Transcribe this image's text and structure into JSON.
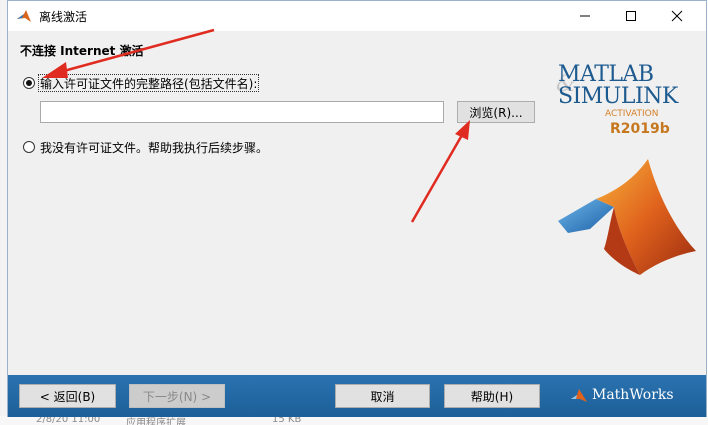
{
  "window": {
    "title": "离线激活",
    "controls": {
      "minimize": "minimize-icon",
      "maximize": "maximize-icon",
      "close": "close-icon"
    }
  },
  "header": {
    "label": "不连接 Internet 激活"
  },
  "options": {
    "license_path": {
      "label": "输入许可证文件的完整路径(包括文件名):",
      "selected": true
    },
    "no_license": {
      "label": "我没有许可证文件。帮助我执行后续步骤。",
      "selected": false
    }
  },
  "path_input": {
    "value": "",
    "placeholder": ""
  },
  "browse_button": {
    "label": "浏览(R)..."
  },
  "logo": {
    "line1": "MATLAB",
    "amp": "&",
    "line2": "SIMULINK",
    "activation": "ACTIVATION",
    "release": "R2019b"
  },
  "footer": {
    "back_label": "< 返回(B)",
    "next_label": "下一步(N) >",
    "cancel_label": "取消",
    "help_label": "帮助(H)",
    "brand": "MathWorks"
  },
  "background": {
    "left_chars": [
      "2",
      "2",
      "2",
      "2",
      "2",
      "2",
      "2",
      "2",
      "2",
      "2",
      "2",
      "2",
      "2",
      "2",
      "2",
      "2",
      "2"
    ],
    "bottom_items": [
      "2/8/20 11:00",
      "应用程序扩展",
      "15 KB"
    ]
  },
  "colors": {
    "bottom_bar": "#1d5f98",
    "logo_blue": "#1c5a8f",
    "logo_orange": "#c6781f",
    "annotation_red": "#e02b20"
  }
}
